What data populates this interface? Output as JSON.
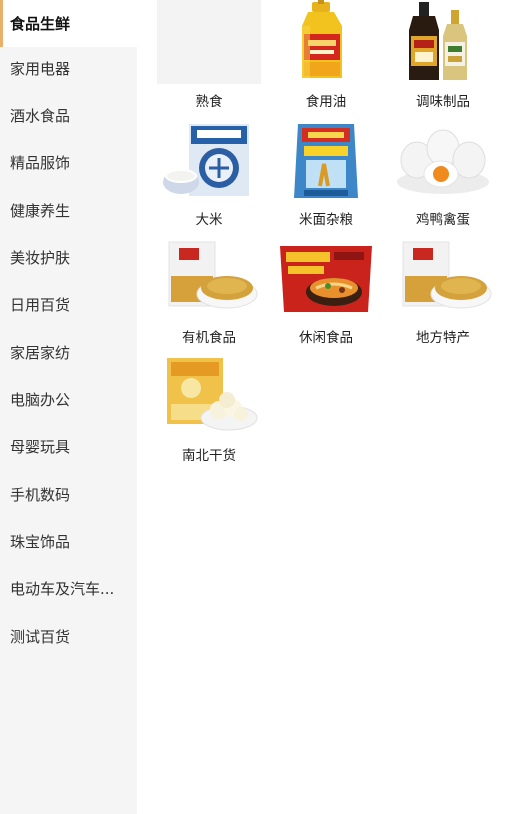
{
  "sidebar": {
    "items": [
      {
        "label": "食品生鲜"
      },
      {
        "label": "家用电器"
      },
      {
        "label": "酒水食品"
      },
      {
        "label": "精品服饰"
      },
      {
        "label": "健康养生"
      },
      {
        "label": "美妆护肤"
      },
      {
        "label": "日用百货"
      },
      {
        "label": "家居家纺"
      },
      {
        "label": "电脑办公"
      },
      {
        "label": "母婴玩具"
      },
      {
        "label": "手机数码"
      },
      {
        "label": "珠宝饰品"
      },
      {
        "label": "电动车及汽车..."
      },
      {
        "label": "测试百货"
      }
    ]
  },
  "categories": [
    {
      "label": "熟食",
      "icon": "placeholder-image"
    },
    {
      "label": "食用油",
      "icon": "cooking-oil-bottle"
    },
    {
      "label": "调味制品",
      "icon": "soy-sauce-bottles"
    },
    {
      "label": "大米",
      "icon": "rice-bag"
    },
    {
      "label": "米面杂粮",
      "icon": "flour-bag"
    },
    {
      "label": "鸡鸭禽蛋",
      "icon": "eggs"
    },
    {
      "label": "有机食品",
      "icon": "millet-bag"
    },
    {
      "label": "休闲食品",
      "icon": "instant-noodles"
    },
    {
      "label": "地方特产",
      "icon": "millet-bag"
    },
    {
      "label": "南北干货",
      "icon": "dried-food-bag"
    }
  ]
}
